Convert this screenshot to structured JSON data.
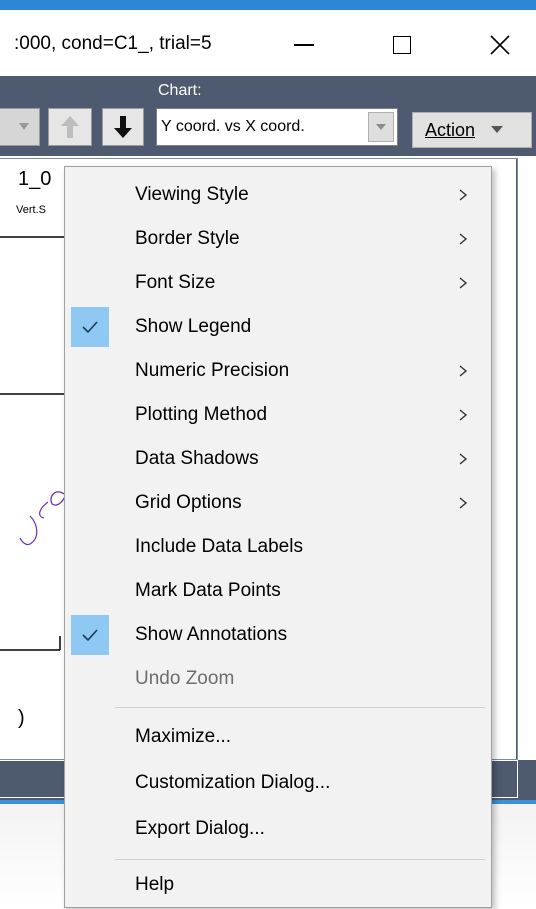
{
  "window": {
    "title": ":000, cond=C1_, trial=5"
  },
  "toolbar": {
    "chart_label": "Chart:",
    "chart_select_value": "Y coord. vs X coord.",
    "action_label": "Action"
  },
  "plot": {
    "title": "1_0",
    "subtitle": "Vert.S",
    "paren": ")"
  },
  "context_menu": {
    "items": [
      {
        "label": "Viewing Style",
        "submenu": true,
        "checked": false,
        "disabled": false
      },
      {
        "label": "Border Style",
        "submenu": true,
        "checked": false,
        "disabled": false
      },
      {
        "label": "Font Size",
        "submenu": true,
        "checked": false,
        "disabled": false
      },
      {
        "label": "Show Legend",
        "submenu": false,
        "checked": true,
        "disabled": false
      },
      {
        "label": "Numeric Precision",
        "submenu": true,
        "checked": false,
        "disabled": false
      },
      {
        "label": "Plotting Method",
        "submenu": true,
        "checked": false,
        "disabled": false
      },
      {
        "label": "Data Shadows",
        "submenu": true,
        "checked": false,
        "disabled": false
      },
      {
        "label": "Grid Options",
        "submenu": true,
        "checked": false,
        "disabled": false
      },
      {
        "label": "Include Data Labels",
        "submenu": false,
        "checked": false,
        "disabled": false
      },
      {
        "label": "Mark Data Points",
        "submenu": false,
        "checked": false,
        "disabled": false
      },
      {
        "label": "Show Annotations",
        "submenu": false,
        "checked": true,
        "disabled": false
      },
      {
        "label": "Undo Zoom",
        "submenu": false,
        "checked": false,
        "disabled": true
      },
      {
        "label": "Maximize...",
        "submenu": false,
        "checked": false,
        "disabled": false
      },
      {
        "label": "Customization Dialog...",
        "submenu": false,
        "checked": false,
        "disabled": false
      },
      {
        "label": "Export Dialog...",
        "submenu": false,
        "checked": false,
        "disabled": false
      },
      {
        "label": "Help",
        "submenu": false,
        "checked": false,
        "disabled": false
      }
    ]
  },
  "icons": {
    "up": "arrow-up-icon",
    "down": "arrow-down-icon",
    "dropdown": "chevron-down-icon",
    "check": "checkmark-icon",
    "submenu": "chevron-right-icon"
  },
  "colors": {
    "toolbar_bg": "#4e5a6f",
    "window_accent": "#2f86d6",
    "check_highlight": "#8fc8f2",
    "disabled_text": "#6d6d6d",
    "plot_trace": "#6a2bb8"
  }
}
